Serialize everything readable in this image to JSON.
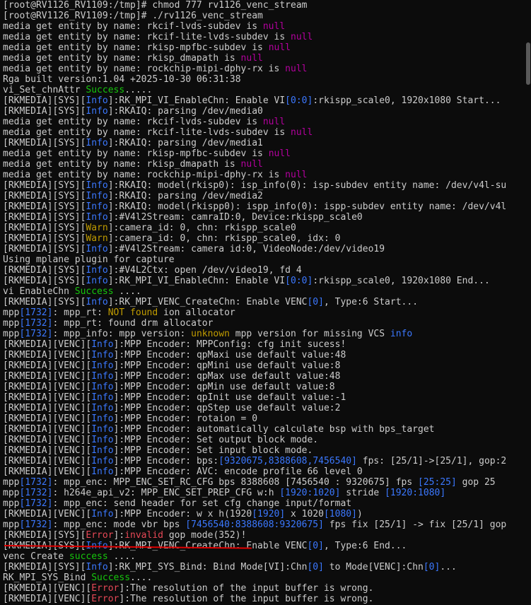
{
  "colors": {
    "default": "#cccccc",
    "info": "#3b78ff",
    "warn": "#c19c00",
    "error": "#e74856",
    "success": "#16c60c",
    "magenta": "#b4009e"
  },
  "lines": [
    [
      [
        "d",
        "[root@RV1126_RV1109:/tmp]# chmod 777 rv1126_venc_stream"
      ]
    ],
    [
      [
        "d",
        "[root@RV1126_RV1109:/tmp]# ./rv1126_venc_stream"
      ]
    ],
    [
      [
        "d",
        "media get entity by name: rkcif-lvds-subdev is "
      ],
      [
        "m",
        "null"
      ]
    ],
    [
      [
        "d",
        "media get entity by name: rkcif-lite-lvds-subdev is "
      ],
      [
        "m",
        "null"
      ]
    ],
    [
      [
        "d",
        "media get entity by name: rkisp-mpfbc-subdev is "
      ],
      [
        "m",
        "null"
      ]
    ],
    [
      [
        "d",
        "media get entity by name: rkisp_dmapath is "
      ],
      [
        "m",
        "null"
      ]
    ],
    [
      [
        "d",
        "media get entity by name: rockchip-mipi-dphy-rx is "
      ],
      [
        "m",
        "null"
      ]
    ],
    [
      [
        "d",
        "Rga built version:1.04 +2025-10-30 06:31:38"
      ]
    ],
    [
      [
        "d",
        "vi_Set_chnAttr "
      ],
      [
        "s",
        "Success"
      ],
      [
        "d",
        "....."
      ]
    ],
    [
      [
        "d",
        "[RKMEDIA][SYS]["
      ],
      [
        "i",
        "Info"
      ],
      [
        "d",
        "]:RK_MPI_VI_EnableChn: Enable VI"
      ],
      [
        "i",
        "[0:0]"
      ],
      [
        "d",
        ":rkispp_scale0, 1920x1080 Start..."
      ]
    ],
    [
      [
        "d",
        "[RKMEDIA][SYS]["
      ],
      [
        "i",
        "Info"
      ],
      [
        "d",
        "]:RKAIQ: parsing /dev/media0"
      ]
    ],
    [
      [
        "d",
        "media get entity by name: rkcif-lvds-subdev is "
      ],
      [
        "m",
        "null"
      ]
    ],
    [
      [
        "d",
        "media get entity by name: rkcif-lite-lvds-subdev is "
      ],
      [
        "m",
        "null"
      ]
    ],
    [
      [
        "d",
        "[RKMEDIA][SYS]["
      ],
      [
        "i",
        "Info"
      ],
      [
        "d",
        "]:RKAIQ: parsing /dev/media1"
      ]
    ],
    [
      [
        "d",
        "media get entity by name: rkisp-mpfbc-subdev is "
      ],
      [
        "m",
        "null"
      ]
    ],
    [
      [
        "d",
        "media get entity by name: rkisp_dmapath is "
      ],
      [
        "m",
        "null"
      ]
    ],
    [
      [
        "d",
        "media get entity by name: rockchip-mipi-dphy-rx is "
      ],
      [
        "m",
        "null"
      ]
    ],
    [
      [
        "d",
        "[RKMEDIA][SYS]["
      ],
      [
        "i",
        "Info"
      ],
      [
        "d",
        "]:RKAIQ: model(rkisp0): isp_info(0): isp-subdev entity name: /dev/v4l-su"
      ]
    ],
    [
      [
        "d",
        "[RKMEDIA][SYS]["
      ],
      [
        "i",
        "Info"
      ],
      [
        "d",
        "]:RKAIQ: parsing /dev/media2"
      ]
    ],
    [
      [
        "d",
        "[RKMEDIA][SYS]["
      ],
      [
        "i",
        "Info"
      ],
      [
        "d",
        "]:RKAIQ: model(rkispp0): ispp_info(0): ispp-subdev entity name: /dev/v4l"
      ]
    ],
    [
      [
        "d",
        "[RKMEDIA][SYS]["
      ],
      [
        "i",
        "Info"
      ],
      [
        "d",
        "]:#V4l2Stream: camraID:0, Device:rkispp_scale0"
      ]
    ],
    [
      [
        "d",
        "[RKMEDIA][SYS]["
      ],
      [
        "w",
        "Warn"
      ],
      [
        "d",
        "]:camera_id: 0, chn: rkispp_scale0"
      ]
    ],
    [
      [
        "d",
        "[RKMEDIA][SYS]["
      ],
      [
        "w",
        "Warn"
      ],
      [
        "d",
        "]:camera_id: 0, chn: rkispp_scale0, idx: 0"
      ]
    ],
    [
      [
        "d",
        "[RKMEDIA][SYS]["
      ],
      [
        "i",
        "Info"
      ],
      [
        "d",
        "]:#V4l2Stream: camera id:0, VideoNode:/dev/video19"
      ]
    ],
    [
      [
        "d",
        "Using mplane plugin for capture"
      ]
    ],
    [
      [
        "d",
        "[RKMEDIA][SYS]["
      ],
      [
        "i",
        "Info"
      ],
      [
        "d",
        "]:#V4L2Ctx: open /dev/video19, fd 4"
      ]
    ],
    [
      [
        "d",
        "[RKMEDIA][SYS]["
      ],
      [
        "i",
        "Info"
      ],
      [
        "d",
        "]:RK_MPI_VI_EnableChn: Enable VI"
      ],
      [
        "i",
        "[0:0]"
      ],
      [
        "d",
        ":rkispp_scale0, 1920x1080 End..."
      ]
    ],
    [
      [
        "d",
        "vi EnableChn "
      ],
      [
        "s",
        "Success"
      ],
      [
        "d",
        " ...."
      ]
    ],
    [
      [
        "d",
        "[RKMEDIA][SYS]["
      ],
      [
        "i",
        "Info"
      ],
      [
        "d",
        "]:RK_MPI_VENC_CreateChn: Enable VENC"
      ],
      [
        "i",
        "[0]"
      ],
      [
        "d",
        ", Type:6 Start..."
      ]
    ],
    [
      [
        "d",
        "mpp"
      ],
      [
        "i",
        "[1732]"
      ],
      [
        "d",
        ": mpp_rt: "
      ],
      [
        "w",
        "NOT found"
      ],
      [
        "d",
        " ion allocator"
      ]
    ],
    [
      [
        "d",
        "mpp"
      ],
      [
        "i",
        "[1732]"
      ],
      [
        "d",
        ": mpp_rt: found drm allocator"
      ]
    ],
    [
      [
        "d",
        "mpp"
      ],
      [
        "i",
        "[1732]"
      ],
      [
        "d",
        ": mpp_info: mpp version: "
      ],
      [
        "w",
        "unknown"
      ],
      [
        "d",
        " mpp version for missing VCS "
      ],
      [
        "i",
        "info"
      ]
    ],
    [
      [
        "d",
        "[RKMEDIA][VENC]["
      ],
      [
        "i",
        "Info"
      ],
      [
        "d",
        "]:MPP Encoder: MPPConfig: cfg init sucess!"
      ]
    ],
    [
      [
        "d",
        "[RKMEDIA][VENC]["
      ],
      [
        "i",
        "Info"
      ],
      [
        "d",
        "]:MPP Encoder: qpMaxi use default value:48"
      ]
    ],
    [
      [
        "d",
        "[RKMEDIA][VENC]["
      ],
      [
        "i",
        "Info"
      ],
      [
        "d",
        "]:MPP Encoder: qpMini use default value:8"
      ]
    ],
    [
      [
        "d",
        "[RKMEDIA][VENC]["
      ],
      [
        "i",
        "Info"
      ],
      [
        "d",
        "]:MPP Encoder: qpMax use default value:48"
      ]
    ],
    [
      [
        "d",
        "[RKMEDIA][VENC]["
      ],
      [
        "i",
        "Info"
      ],
      [
        "d",
        "]:MPP Encoder: qpMin use default value:8"
      ]
    ],
    [
      [
        "d",
        "[RKMEDIA][VENC]["
      ],
      [
        "i",
        "Info"
      ],
      [
        "d",
        "]:MPP Encoder: qpInit use default value:-1"
      ]
    ],
    [
      [
        "d",
        "[RKMEDIA][VENC]["
      ],
      [
        "i",
        "Info"
      ],
      [
        "d",
        "]:MPP Encoder: qpStep use default value:2"
      ]
    ],
    [
      [
        "d",
        "[RKMEDIA][VENC]["
      ],
      [
        "i",
        "Info"
      ],
      [
        "d",
        "]:MPP Encoder: rotaion = 0"
      ]
    ],
    [
      [
        "d",
        "[RKMEDIA][VENC]["
      ],
      [
        "i",
        "Info"
      ],
      [
        "d",
        "]:MPP Encoder: automatically calculate bsp with bps_target"
      ]
    ],
    [
      [
        "d",
        "[RKMEDIA][VENC]["
      ],
      [
        "i",
        "Info"
      ],
      [
        "d",
        "]:MPP Encoder: Set output block mode."
      ]
    ],
    [
      [
        "d",
        "[RKMEDIA][VENC]["
      ],
      [
        "i",
        "Info"
      ],
      [
        "d",
        "]:MPP Encoder: Set input block mode."
      ]
    ],
    [
      [
        "d",
        "[RKMEDIA][VENC]["
      ],
      [
        "i",
        "Info"
      ],
      [
        "d",
        "]:MPP Encoder: bps:"
      ],
      [
        "i",
        "[9320675,8388608,7456540]"
      ],
      [
        "d",
        " fps: [25/1]->[25/1], gop:2"
      ]
    ],
    [
      [
        "d",
        "[RKMEDIA][VENC]["
      ],
      [
        "i",
        "Info"
      ],
      [
        "d",
        "]:MPP Encoder: AVC: encode profile 66 level 0"
      ]
    ],
    [
      [
        "d",
        "mpp"
      ],
      [
        "i",
        "[1732]"
      ],
      [
        "d",
        ": mpp_enc: MPP_ENC_SET_RC_CFG bps 8388608 [7456540 : 9320675] fps "
      ],
      [
        "i",
        "[25:25]"
      ],
      [
        "d",
        " gop 25"
      ]
    ],
    [
      [
        "d",
        "mpp"
      ],
      [
        "i",
        "[1732]"
      ],
      [
        "d",
        ": h264e_api_v2: MPP_ENC_SET_PREP_CFG w:h "
      ],
      [
        "i",
        "[1920:1020]"
      ],
      [
        "d",
        " stride "
      ],
      [
        "i",
        "[1920:1080]"
      ]
    ],
    [
      [
        "d",
        "mpp"
      ],
      [
        "i",
        "[1732]"
      ],
      [
        "d",
        ": mpp_enc: send header for set cfg change input/format"
      ]
    ],
    [
      [
        "d",
        "[RKMEDIA][VENC]["
      ],
      [
        "i",
        "Info"
      ],
      [
        "d",
        "]:MPP Encoder: w x h(1920"
      ],
      [
        "i",
        "[1920]"
      ],
      [
        "d",
        " x 1020"
      ],
      [
        "i",
        "[1080]"
      ],
      [
        "d",
        ")"
      ]
    ],
    [
      [
        "d",
        "mpp"
      ],
      [
        "i",
        "[1732]"
      ],
      [
        "d",
        ": mpp_enc: mode vbr bps "
      ],
      [
        "i",
        "[7456540:8388608:9320675]"
      ],
      [
        "d",
        " fps fix [25/1] -> fix [25/1] gop"
      ]
    ],
    [
      [
        "d",
        "[RKMEDIA][SYS]["
      ],
      [
        "e",
        "Error"
      ],
      [
        "d",
        "]:"
      ],
      [
        "e",
        "invalid"
      ],
      [
        "d",
        " gop mode(352)!"
      ]
    ],
    [
      [
        "d",
        "[RKMEDIA][SYS]["
      ],
      [
        "i",
        "Info"
      ],
      [
        "d",
        "]:RK_MPI_VENC_CreateChn: Enable VENC"
      ],
      [
        "i",
        "[0]"
      ],
      [
        "d",
        ", Type:6 End..."
      ]
    ],
    [
      [
        "d",
        "venc Create "
      ],
      [
        "s",
        "success"
      ],
      [
        "d",
        " ...."
      ]
    ],
    [
      [
        "d",
        "[RKMEDIA][SYS]["
      ],
      [
        "i",
        "Info"
      ],
      [
        "d",
        "]:RK_MPI_SYS_Bind: Bind Mode[VI]:Chn"
      ],
      [
        "i",
        "[0]"
      ],
      [
        "d",
        " to Mode[VENC]:Chn"
      ],
      [
        "i",
        "[0]"
      ],
      [
        "d",
        "..."
      ]
    ],
    [
      [
        "d",
        "RK_MPI_SYS_Bind "
      ],
      [
        "s",
        "Success"
      ],
      [
        "d",
        "...."
      ]
    ],
    [
      [
        "d",
        "[RKMEDIA][VENC]["
      ],
      [
        "e",
        "Error"
      ],
      [
        "d",
        "]:The resolution of the input buffer is wrong."
      ]
    ],
    [
      [
        "d",
        "[RKMEDIA][VENC]["
      ],
      [
        "e",
        "Error"
      ],
      [
        "d",
        "]:The resolution of the input buffer is wrong."
      ]
    ]
  ]
}
